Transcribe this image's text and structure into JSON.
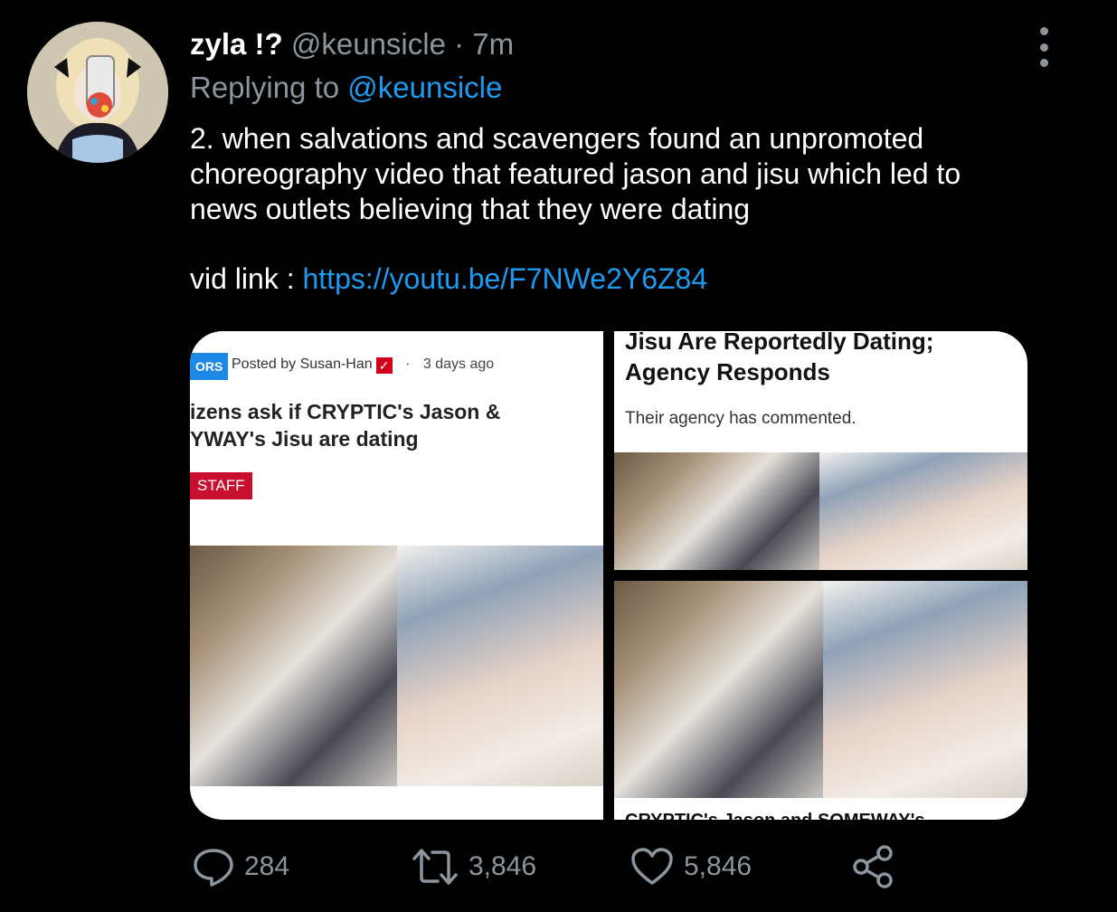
{
  "tweet": {
    "display_name": "zyla !?",
    "handle": "@keunsicle",
    "separator": "·",
    "time": "7m",
    "replying_prefix": "Replying to",
    "replying_handle": "@keunsicle",
    "text_lines": [
      "2. when salvations and scavengers found an unpromoted",
      "choreography video that featured jason and jisu which led to",
      "news outlets believing that they were dating"
    ],
    "vid_label": "vid link :",
    "vid_url": "https://youtu.be/F7NWe2Y6Z84"
  },
  "media": {
    "left": {
      "category_tag": "ORS",
      "posted_by": "Posted by Susan-Han",
      "check_mark": "✓",
      "dot": "·",
      "posted_ago": "3 days ago",
      "headline_line1": "izens ask if CRYPTIC's Jason &",
      "headline_line2": "YWAY's Jisu are dating",
      "staff_tag": "STAFF"
    },
    "right": {
      "headline_line1": "Jisu Are Reportedly Dating;",
      "headline_line2": "Agency Responds",
      "subtext": "Their agency has commented.",
      "cut_text": "CRYPTIC's Jason and SOMEWAY's"
    }
  },
  "actions": {
    "reply_count": "284",
    "retweet_count": "3,846",
    "like_count": "5,846"
  },
  "colors": {
    "background": "#000000",
    "link": "#1d9bf0",
    "muted": "#8b959e",
    "text": "#ffffff"
  },
  "icons": [
    "more-options-icon",
    "reply-icon",
    "retweet-icon",
    "like-icon",
    "share-icon"
  ]
}
